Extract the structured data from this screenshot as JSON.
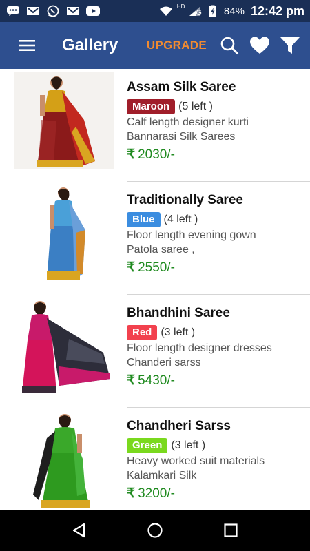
{
  "status": {
    "icons": [
      "chat-icon",
      "mail-icon",
      "whatsapp-icon",
      "mail-icon",
      "youtube-icon"
    ],
    "hd": "HD",
    "network": "G",
    "battery": "84%",
    "time": "12:42 pm"
  },
  "appbar": {
    "title": "Gallery",
    "upgrade": "UPGRADE"
  },
  "items": [
    {
      "title": "Assam Silk Saree",
      "color": "Maroon",
      "color_hex": "#a01e2a",
      "left": "(5 left )",
      "desc1": "Calf length designer kurti",
      "desc2": "Bannarasi Silk Sarees",
      "currency": "₹",
      "price": "2030/-"
    },
    {
      "title": "Traditionally Saree",
      "color": "Blue",
      "color_hex": "#3b8de0",
      "left": "(4 left )",
      "desc1": "Floor length evening gown",
      "desc2": "Patola saree ,",
      "currency": "₹",
      "price": "2550/-"
    },
    {
      "title": "Bhandhini Saree",
      "color": "Red",
      "color_hex": "#f2414e",
      "left": "(3 left )",
      "desc1": "Floor length designer dresses",
      "desc2": "Chanderi sarss",
      "currency": "₹",
      "price": "5430/-"
    },
    {
      "title": "Chandheri Sarss",
      "color": "Green",
      "color_hex": "#7ad91e",
      "left": "(3 left )",
      "desc1": "Heavy worked suit materials",
      "desc2": "Kalamkari Silk",
      "currency": "₹",
      "price": "3200/-"
    }
  ]
}
